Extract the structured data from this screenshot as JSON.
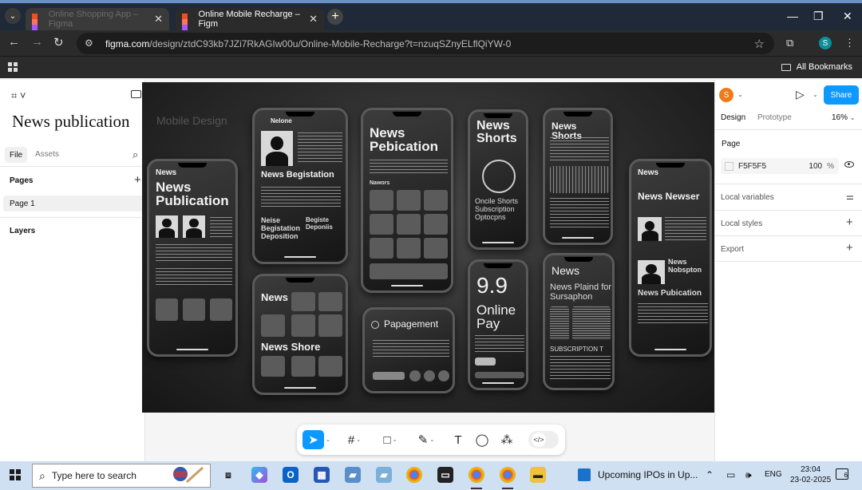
{
  "browser": {
    "tabs": [
      {
        "title": "Online Shopping App – Figma"
      },
      {
        "title": "Online Mobile Recharge – Figm"
      }
    ],
    "url_host": "figma.com",
    "url_path": "/design/ztdC93kb7JZi7RkAGIw00u/Online-Mobile-Recharge?t=nzuqSZnyELflQiYW-0",
    "profile_initial": "S",
    "all_bookmarks": "All Bookmarks"
  },
  "left_panel": {
    "file_name": "News publication",
    "tabs": {
      "file": "File",
      "assets": "Assets"
    },
    "pages_heading": "Pages",
    "pages": [
      "Page 1"
    ],
    "layers_heading": "Layers"
  },
  "canvas": {
    "watermark": "Mobile Design",
    "phones": {
      "p1_title": "News Publication",
      "p1_small": "News",
      "p2_header": "Nelone",
      "p2_title": "News Begistation",
      "p2_sub": "Neise Begistation Deposition",
      "p2_sub2": "Begiste Deponiis",
      "p3_title": "News Pebication",
      "p3_label": "Nawors",
      "p4_title": "News Shorts",
      "p4_sub": "Oncile Shorts Subscription Optocpns",
      "p5_title": "News Shorts",
      "p6_title": "News Shore",
      "p6_small": "News",
      "p7_title": "Papagement",
      "p8_big": "9.9",
      "p8_title": "Online Pay",
      "p9_title": "News",
      "p9_sub": "News Plaind for Sursaphon",
      "p9_footer": "SUBSCRIPTION T",
      "p10_small": "News",
      "p10_title": "News Newser",
      "p10_sub1": "News Nobspton",
      "p10_sub2": "News Pubication"
    }
  },
  "toolbar": {
    "tools": [
      "move",
      "frame",
      "rectangle",
      "pen",
      "text",
      "comment",
      "actions",
      "dev-mode"
    ]
  },
  "right_panel": {
    "user_initial": "S",
    "share": "Share",
    "tabs": {
      "design": "Design",
      "prototype": "Prototype"
    },
    "zoom": "16%",
    "page_heading": "Page",
    "page_color": "F5F5F5",
    "page_opacity": "100",
    "page_opacity_unit": "%",
    "local_variables": "Local variables",
    "local_styles": "Local styles",
    "export": "Export"
  },
  "help_label": "?",
  "taskbar": {
    "search_placeholder": "Type here to search",
    "news": "Upcoming IPOs in Up...",
    "lang": "ENG",
    "time": "23:04",
    "date": "23-02-2025",
    "notif_count": "6"
  }
}
